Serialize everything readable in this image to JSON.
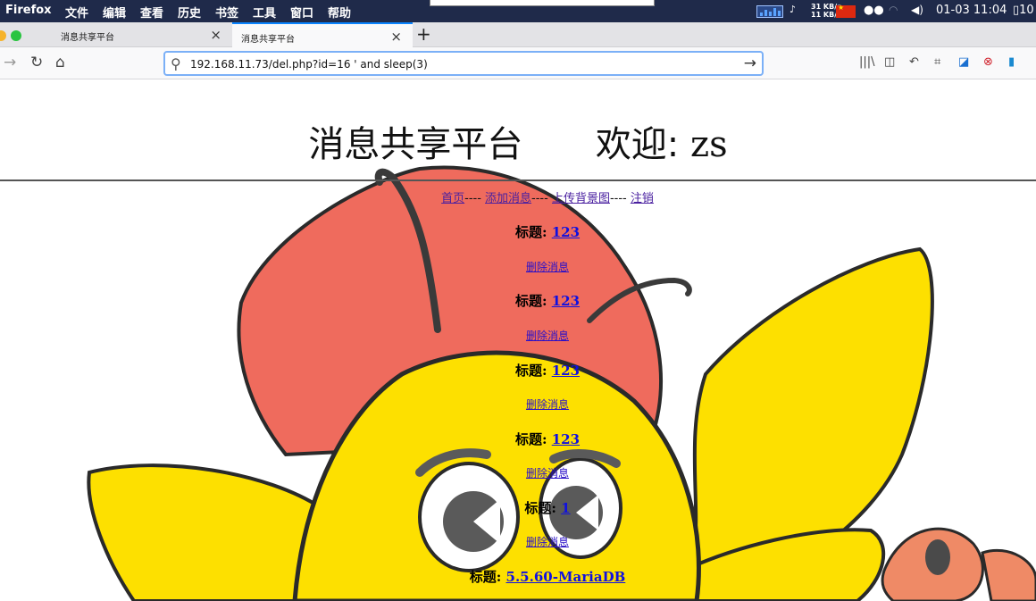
{
  "menubar": {
    "app": "Firefox",
    "items": [
      "文件",
      "编辑",
      "查看",
      "历史",
      "书签",
      "工具",
      "窗口",
      "帮助"
    ],
    "net_up": "31 KB/s",
    "net_down": "11 KB/s",
    "clock": "01-03 11:04",
    "battery": "10"
  },
  "tabs": [
    {
      "label": "消息共享平台"
    },
    {
      "label": "消息共享平台"
    }
  ],
  "url": "192.168.11.73/del.php?id=16 ' and sleep(3)",
  "page": {
    "title_text": "消息共享平台",
    "welcome_label": "欢迎:",
    "username": "zs",
    "nav": {
      "home": "首页",
      "add": "添加消息",
      "upload": "上传背景图",
      "logout": "注销",
      "sep": "----"
    },
    "title_label": "标题:",
    "delete_label": "删除消息",
    "entries": [
      {
        "title": "123"
      },
      {
        "title": "123"
      },
      {
        "title": "123"
      },
      {
        "title": "123"
      },
      {
        "title": "1"
      },
      {
        "title": "5.5.60-MariaDB"
      }
    ]
  },
  "colors": {
    "menubar": "#1f2a4a",
    "accent": "#0a84ff",
    "bee_body": "#ef6b5d",
    "bee_yellow": "#fde000"
  },
  "icons": [
    "back-icon",
    "forward-icon",
    "reload-icon",
    "home-icon",
    "search-icon",
    "go-arrow-icon",
    "library-icon",
    "sidebar-icon",
    "undo-icon",
    "crop-icon",
    "screenshot-icon",
    "block-icon",
    "extension-icon"
  ]
}
